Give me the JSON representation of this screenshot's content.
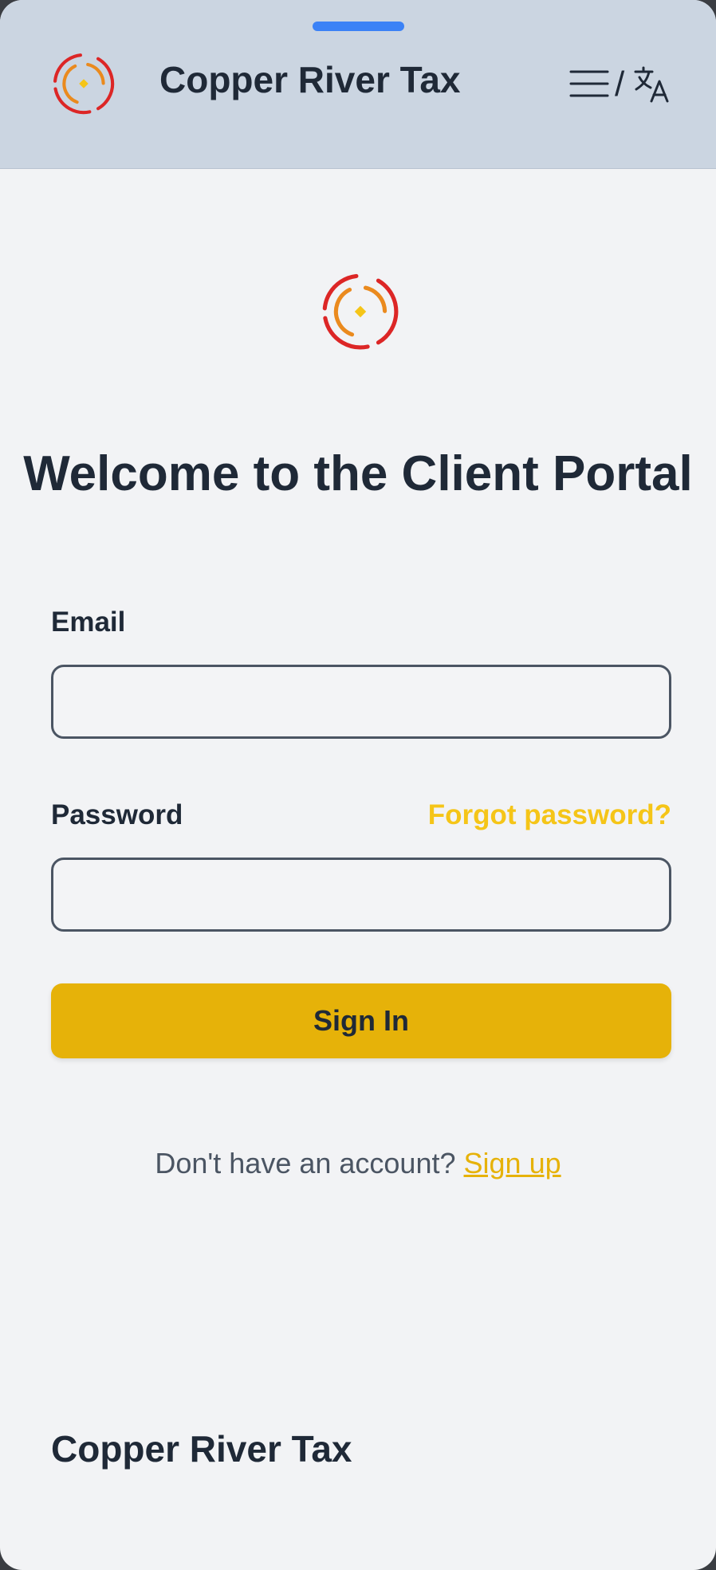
{
  "header": {
    "brand_name": "Copper River Tax",
    "separator": "/",
    "logo_icon": "brand-logo-icon",
    "menu_icon": "hamburger-menu-icon",
    "language_icon": "translate-icon"
  },
  "main": {
    "logo_icon": "brand-logo-icon",
    "title": "Welcome to the Client Portal"
  },
  "form": {
    "email_label": "Email",
    "email_value": "",
    "password_label": "Password",
    "password_value": "",
    "forgot_password": "Forgot password?",
    "sign_in": "Sign In"
  },
  "signup": {
    "prompt": "Don't have an account?",
    "link": "Sign up"
  },
  "footer": {
    "brand_name": "Copper River Tax"
  },
  "colors": {
    "header_bg": "#cbd5e1",
    "page_bg": "#f2f3f5",
    "accent_gold": "#e6b209",
    "link_yellow": "#f5c518",
    "drag_handle": "#3b82f6",
    "logo_red": "#dc2626",
    "logo_orange": "#ea8a1e",
    "text_dark": "#1f2937"
  }
}
